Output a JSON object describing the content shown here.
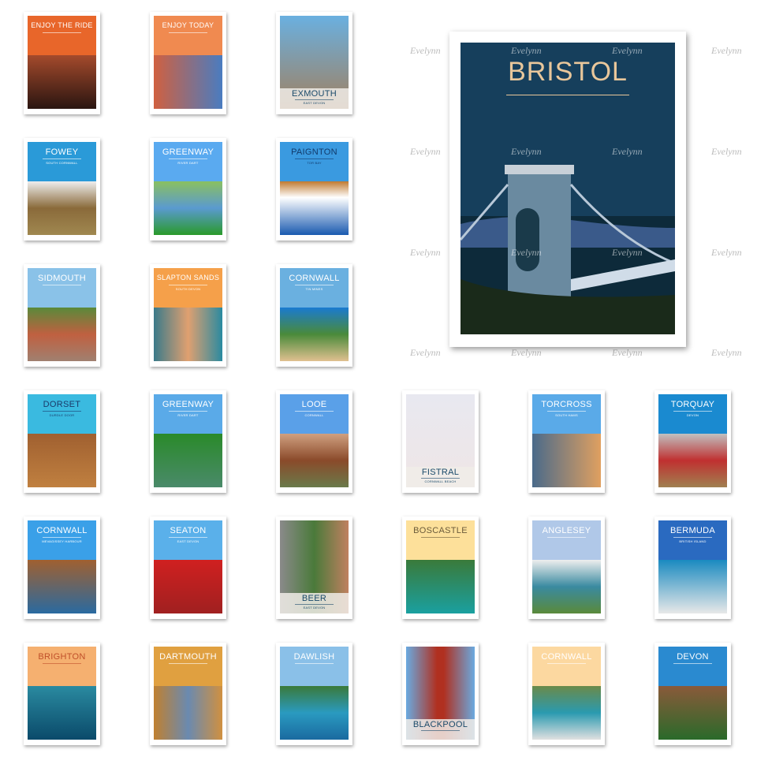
{
  "watermark": "Evelynn",
  "featured": {
    "title": "BRISTOL",
    "bg": "#163f5c",
    "title_color": "#e9c79b"
  },
  "posters": [
    {
      "title": "ENJOY THE RIDE",
      "sub": "",
      "sky": "#e8662a",
      "scene": "linear-gradient(#a44a2c,#2a1510)",
      "tc": "#fff",
      "pos": "top"
    },
    {
      "title": "ENJOY TODAY",
      "sub": "",
      "sky": "#f08a50",
      "scene": "linear-gradient(90deg,#d06040,#4a7cc0)",
      "tc": "#fff",
      "pos": "top"
    },
    {
      "title": "EXMOUTH",
      "sub": "EAST DEVON",
      "sky": "#4a8ac8",
      "scene": "linear-gradient(#6ab0e0,#a08060)",
      "tc": "#fff",
      "pos": "bottom"
    },
    {
      "title": "FOWEY",
      "sub": "SOUTH CORNWALL",
      "sky": "#2a9ad8",
      "scene": "linear-gradient(#eee,#8a6a3a,#a08850)",
      "tc": "#fff",
      "pos": "top"
    },
    {
      "title": "GREENWAY",
      "sub": "RIVER DART",
      "sky": "#5aaaf0",
      "scene": "linear-gradient(#8ac060,#5a9ad0,#2a9a2a)",
      "tc": "#fff",
      "pos": "top"
    },
    {
      "title": "PAIGNTON",
      "sub": "TOR BAY",
      "sky": "#3a9ae0",
      "scene": "linear-gradient(#c07a30,#fff 30%,#1a5ab0)",
      "tc": "#123a6a",
      "pos": "top"
    },
    {
      "title": "SIDMOUTH",
      "sub": "",
      "sky": "#8ac2e8",
      "scene": "linear-gradient(#5a8a3a,#c06040,#a08070)",
      "tc": "#fff",
      "pos": "top"
    },
    {
      "title": "SLAPTON SANDS",
      "sub": "SOUTH DEVON",
      "sky": "#f5a04a",
      "scene": "linear-gradient(90deg,#3a7a8a,#e0a070,#2a8aa0)",
      "tc": "#fff",
      "pos": "top"
    },
    {
      "title": "CORNWALL",
      "sub": "TIN MINES",
      "sky": "#6ab0e0",
      "scene": "linear-gradient(#1a7ad0,#4a8a3a,#e0c090)",
      "tc": "#fff",
      "pos": "top"
    },
    {
      "title": "DORSET",
      "sub": "DURDLE DOOR",
      "sky": "#3abae0",
      "scene": "linear-gradient(#a06030,#c08040)",
      "tc": "#1a3a6a",
      "pos": "top"
    },
    {
      "title": "GREENWAY",
      "sub": "RIVER DART",
      "sky": "#5aaae8",
      "scene": "linear-gradient(#2a8a2a,#4a8a6a)",
      "tc": "#fff",
      "pos": "top"
    },
    {
      "title": "LOOE",
      "sub": "CORNWALL",
      "sky": "#5aa0e8",
      "scene": "linear-gradient(#d0a080,#8a4a2a,#6a7a4a)",
      "tc": "#fff",
      "pos": "top"
    },
    {
      "title": "FISTRAL",
      "sub": "CORNWALL BEACH",
      "sky": "#2ab0a0",
      "scene": "linear-gradient(#e8e8f0,#efe6e6)",
      "tc": "#1a5a7a",
      "pos": "bottom"
    },
    {
      "title": "TORCROSS",
      "sub": "SOUTH HAMS",
      "sky": "#5aaae8",
      "scene": "linear-gradient(90deg,#4a6a8a,#e0a060)",
      "tc": "#fff",
      "pos": "top"
    },
    {
      "title": "TORQUAY",
      "sub": "DEVON",
      "sky": "#1a8ad0",
      "scene": "linear-gradient(#c0c0c0,#c03030,#a08050)",
      "tc": "#fff",
      "pos": "top"
    },
    {
      "title": "CORNWALL",
      "sub": "MEVAGISSEY HARBOUR",
      "sky": "#3aa0e8",
      "scene": "linear-gradient(#a06030,#2a6aa0)",
      "tc": "#fff",
      "pos": "top"
    },
    {
      "title": "SEATON",
      "sub": "EAST DEVON",
      "sky": "#5ab0ea",
      "scene": "linear-gradient(#d02020,#a02020)",
      "tc": "#fff",
      "pos": "top"
    },
    {
      "title": "BEER",
      "sub": "EAST DEVON",
      "sky": "#f5a050",
      "scene": "linear-gradient(90deg,#8a8a8a,#4a7a3a,#c08060)",
      "tc": "#fff",
      "pos": "bottom"
    },
    {
      "title": "BOSCASTLE",
      "sub": "",
      "sky": "#fde09a",
      "scene": "linear-gradient(#3a7a3a,#1aa0a0)",
      "tc": "#6a5a3a",
      "pos": "top"
    },
    {
      "title": "ANGLESEY",
      "sub": "",
      "sky": "#b0c8e8",
      "scene": "linear-gradient(#eee,#3a8aa0,#5a8a3a)",
      "tc": "#fff",
      "pos": "top"
    },
    {
      "title": "BERMUDA",
      "sub": "BRITISH ISLAND",
      "sky": "#2a6ac0",
      "scene": "linear-gradient(#1a8ac0,#e8e8e8)",
      "tc": "#fff",
      "pos": "top"
    },
    {
      "title": "BRIGHTON",
      "sub": "",
      "sky": "#f5b070",
      "scene": "linear-gradient(#2a8aa0,#0a4a6a)",
      "tc": "#c0502a",
      "pos": "top"
    },
    {
      "title": "DARTMOUTH",
      "sub": "",
      "sky": "#e0a040",
      "scene": "linear-gradient(90deg,#c08030,#6a8ab0,#d09040)",
      "tc": "#fff",
      "pos": "top"
    },
    {
      "title": "DAWLISH",
      "sub": "",
      "sky": "#8ac0e8",
      "scene": "linear-gradient(#3a7a3a,#2a9ac0,#1a6aa0)",
      "tc": "#fff",
      "pos": "top"
    },
    {
      "title": "BLACKPOOL",
      "sub": "",
      "sky": "#6aaae0",
      "scene": "linear-gradient(90deg,#6aaae0,#b03020 45%,#b03020 55%,#6aaae0)",
      "tc": "#fff",
      "pos": "bottom"
    },
    {
      "title": "CORNWALL",
      "sub": "",
      "sky": "#fcd8a0",
      "scene": "linear-gradient(#6a8a4a,#2a9ab0,#e0e0e0)",
      "tc": "#fff",
      "pos": "top"
    },
    {
      "title": "DEVON",
      "sub": "",
      "sky": "#2a8ad0",
      "scene": "linear-gradient(#8a5a3a,#2a6a2a)",
      "tc": "#fff",
      "pos": "top"
    }
  ]
}
